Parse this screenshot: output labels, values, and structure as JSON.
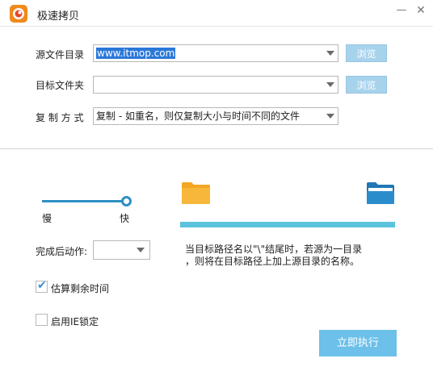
{
  "window": {
    "title": "极速拷贝",
    "minimize_glyph": "—",
    "close_glyph": "✕",
    "logo_icon": "app-logo-icon"
  },
  "form": {
    "source_label": "源文件目录",
    "source_value": "www.itmop.com",
    "target_label": "目标文件夹",
    "target_value": "",
    "mode_label": "复 制 方 式",
    "mode_value": "复制 - 如重名，则仅复制大小与时间不同的文件",
    "browse_label": "浏览"
  },
  "speed": {
    "slow_label": "慢",
    "fast_label": "快",
    "level": 1.0
  },
  "progress": {
    "value": 1.0,
    "source_icon": "folder-icon",
    "target_icon": "folder-open-icon"
  },
  "options": {
    "after_label": "完成后动作:",
    "after_value": "",
    "estimate_label": "估算剩余时间",
    "estimate_checked": true,
    "ie_lock_label": "启用IE锁定",
    "ie_lock_checked": false
  },
  "hint": {
    "line1": "当目标路径名以\"\\\"结尾时，若源为一目录",
    "line2": "，则将在目标路径上加上源目录的名称。"
  },
  "actions": {
    "run_label": "立即执行"
  },
  "colors": {
    "accent": "#2e8fc4",
    "button": "#6cc0ea",
    "browse": "#a7d2ec",
    "progress": "#5bc3dc"
  }
}
